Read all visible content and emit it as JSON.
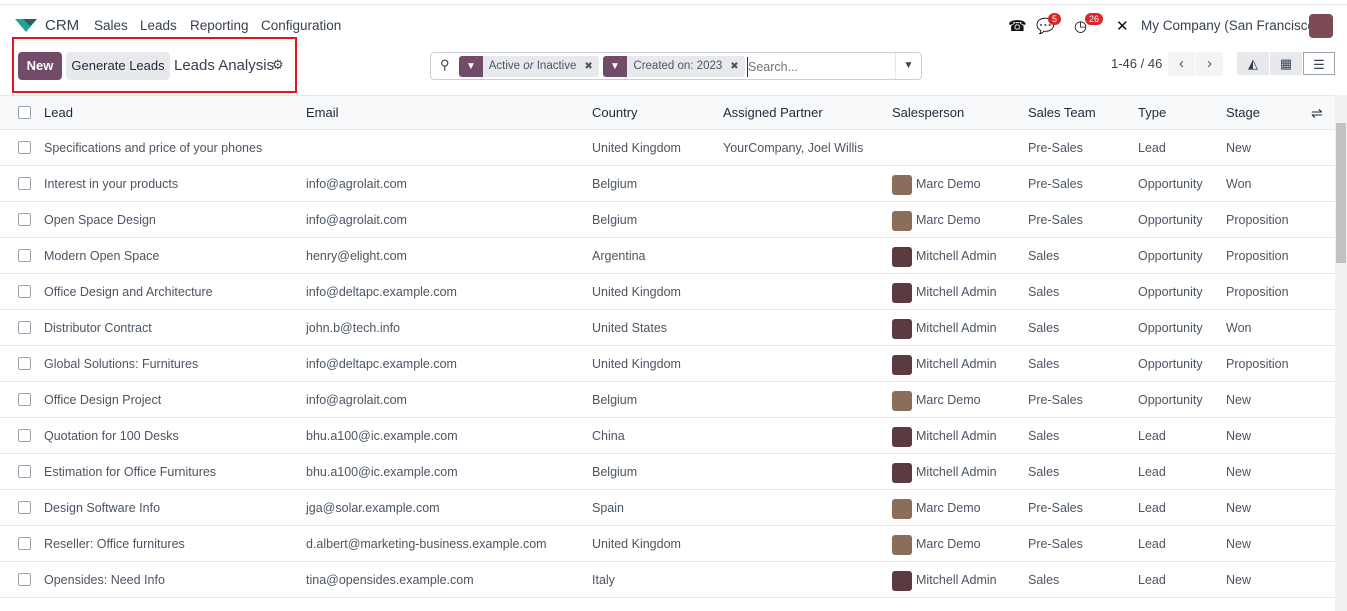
{
  "nav": {
    "app": "CRM",
    "menus": [
      "Sales",
      "Leads",
      "Reporting",
      "Configuration"
    ],
    "chat_badge": "5",
    "activity_badge": "26",
    "company": "My Company (San Francisco)"
  },
  "control": {
    "new": "New",
    "generate": "Generate Leads",
    "title": "Leads Analysis"
  },
  "search": {
    "facet1_a": "Active",
    "facet1_or": "or",
    "facet1_b": "Inactive",
    "facet2": "Created on: 2023",
    "placeholder": "Search..."
  },
  "pager": "1-46 / 46",
  "columns": [
    "Lead",
    "Email",
    "Country",
    "Assigned Partner",
    "Salesperson",
    "Sales Team",
    "Type",
    "Stage"
  ],
  "avatar_colors": {
    "Marc Demo": "#8a6d5a",
    "Mitchell Admin": "#5b3a40"
  },
  "rows": [
    [
      "Specifications and price of your phones",
      "",
      "United Kingdom",
      "YourCompany, Joel Willis",
      "",
      "Pre-Sales",
      "Lead",
      "New"
    ],
    [
      "Interest in your products",
      "info@agrolait.com",
      "Belgium",
      "",
      "Marc Demo",
      "Pre-Sales",
      "Opportunity",
      "Won"
    ],
    [
      "Open Space Design",
      "info@agrolait.com",
      "Belgium",
      "",
      "Marc Demo",
      "Pre-Sales",
      "Opportunity",
      "Proposition"
    ],
    [
      "Modern Open Space",
      "henry@elight.com",
      "Argentina",
      "",
      "Mitchell Admin",
      "Sales",
      "Opportunity",
      "Proposition"
    ],
    [
      "Office Design and Architecture",
      "info@deltapc.example.com",
      "United Kingdom",
      "",
      "Mitchell Admin",
      "Sales",
      "Opportunity",
      "Proposition"
    ],
    [
      "Distributor Contract",
      "john.b@tech.info",
      "United States",
      "",
      "Mitchell Admin",
      "Sales",
      "Opportunity",
      "Won"
    ],
    [
      "Global Solutions: Furnitures",
      "info@deltapc.example.com",
      "United Kingdom",
      "",
      "Mitchell Admin",
      "Sales",
      "Opportunity",
      "Proposition"
    ],
    [
      "Office Design Project",
      "info@agrolait.com",
      "Belgium",
      "",
      "Marc Demo",
      "Pre-Sales",
      "Opportunity",
      "New"
    ],
    [
      "Quotation for 100 Desks",
      "bhu.a100@ic.example.com",
      "China",
      "",
      "Mitchell Admin",
      "Sales",
      "Lead",
      "New"
    ],
    [
      "Estimation for Office Furnitures",
      "bhu.a100@ic.example.com",
      "Belgium",
      "",
      "Mitchell Admin",
      "Sales",
      "Lead",
      "New"
    ],
    [
      "Design Software Info",
      "jga@solar.example.com",
      "Spain",
      "",
      "Marc Demo",
      "Pre-Sales",
      "Lead",
      "New"
    ],
    [
      "Reseller: Office furnitures",
      "d.albert@marketing-business.example.com",
      "United Kingdom",
      "",
      "Marc Demo",
      "Pre-Sales",
      "Lead",
      "New"
    ],
    [
      "Opensides: Need Info",
      "tina@opensides.example.com",
      "Italy",
      "",
      "Mitchell Admin",
      "Sales",
      "Lead",
      "New"
    ]
  ]
}
